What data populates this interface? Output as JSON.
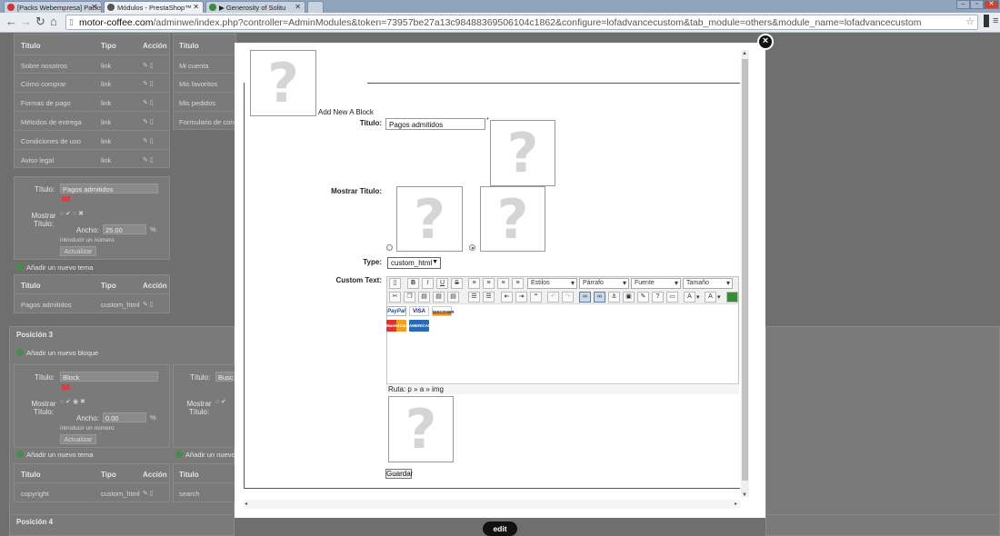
{
  "browser": {
    "tabs": [
      {
        "label": "[Packs Webempresa] Packs"
      },
      {
        "label": "Módulos - PrestaShop™"
      },
      {
        "label": "▶ Generosity of Solitu"
      }
    ],
    "url_host": "motor-coffee.com",
    "url_rest": "/adminwe/index.php?controller=AdminModules&token=73957be27a13c98488369506104c1862&configure=lofadvancecustom&tab_module=others&module_name=lofadvancecustom"
  },
  "background": {
    "col_titulo": "Titulo",
    "col_tipo": "Tipo",
    "col_accion": "Acción",
    "left_rows": [
      {
        "titulo": "Sobre nosotros",
        "tipo": "link"
      },
      {
        "titulo": "Cómo comprar",
        "tipo": "link"
      },
      {
        "titulo": "Formas de pago",
        "tipo": "link"
      },
      {
        "titulo": "Métodos de entrega",
        "tipo": "link"
      },
      {
        "titulo": "Condiciones de uso",
        "tipo": "link"
      },
      {
        "titulo": "Aviso legal",
        "tipo": "link"
      }
    ],
    "right_rows": [
      {
        "titulo": "Mi cuenta"
      },
      {
        "titulo": "Mis favoritos"
      },
      {
        "titulo": "Mis pedidos"
      },
      {
        "titulo": "Formulario de cont"
      }
    ],
    "form1": {
      "titulo_label": "Título:",
      "titulo_value": "Pagos admitidos",
      "mostrar_label": "Mostrar Título:",
      "ancho_label": "Ancho:",
      "ancho_value": "25.00",
      "percent": "%",
      "hint": "introducir un número",
      "actualizar": "Actualizar",
      "add_tema": "Añadir un nuevo tema"
    },
    "table2_row": {
      "titulo": "Pagos admitidos",
      "tipo": "custom_html"
    },
    "posicion3": "Posición 3",
    "add_bloque": "Añadir un nuevo bloque",
    "form2": {
      "titulo_value": "Block",
      "ancho_value": "0.00",
      "right_titulo_value": "Busc"
    },
    "table3_left_row": {
      "titulo": "copyright",
      "tipo": "custom_html"
    },
    "table3_right_row": {
      "titulo": "search"
    },
    "posicion4": "Posición 4"
  },
  "modal": {
    "add_block": "Add New A Block",
    "titulo_label": "Titulo:",
    "titulo_value": "Pagos admitidos",
    "required_mark": "*",
    "mostrar_label": "Mostrar Titulo:",
    "type_label": "Type:",
    "type_value": "custom_html",
    "custom_text_label": "Custom Text:",
    "editor": {
      "estilos": "Estilos",
      "parrafo": "Párrafo",
      "fuente": "Fuente",
      "tamano": "Tamaño",
      "path": "Ruta: p » a » img"
    },
    "cards": {
      "paypal": "PayPal",
      "visa": "VISA",
      "discover": "DISCOVER",
      "mastercard": "MasterCard",
      "amex": "AMERICAN"
    },
    "save": "Guardar",
    "edit": "edit",
    "close": "×"
  }
}
